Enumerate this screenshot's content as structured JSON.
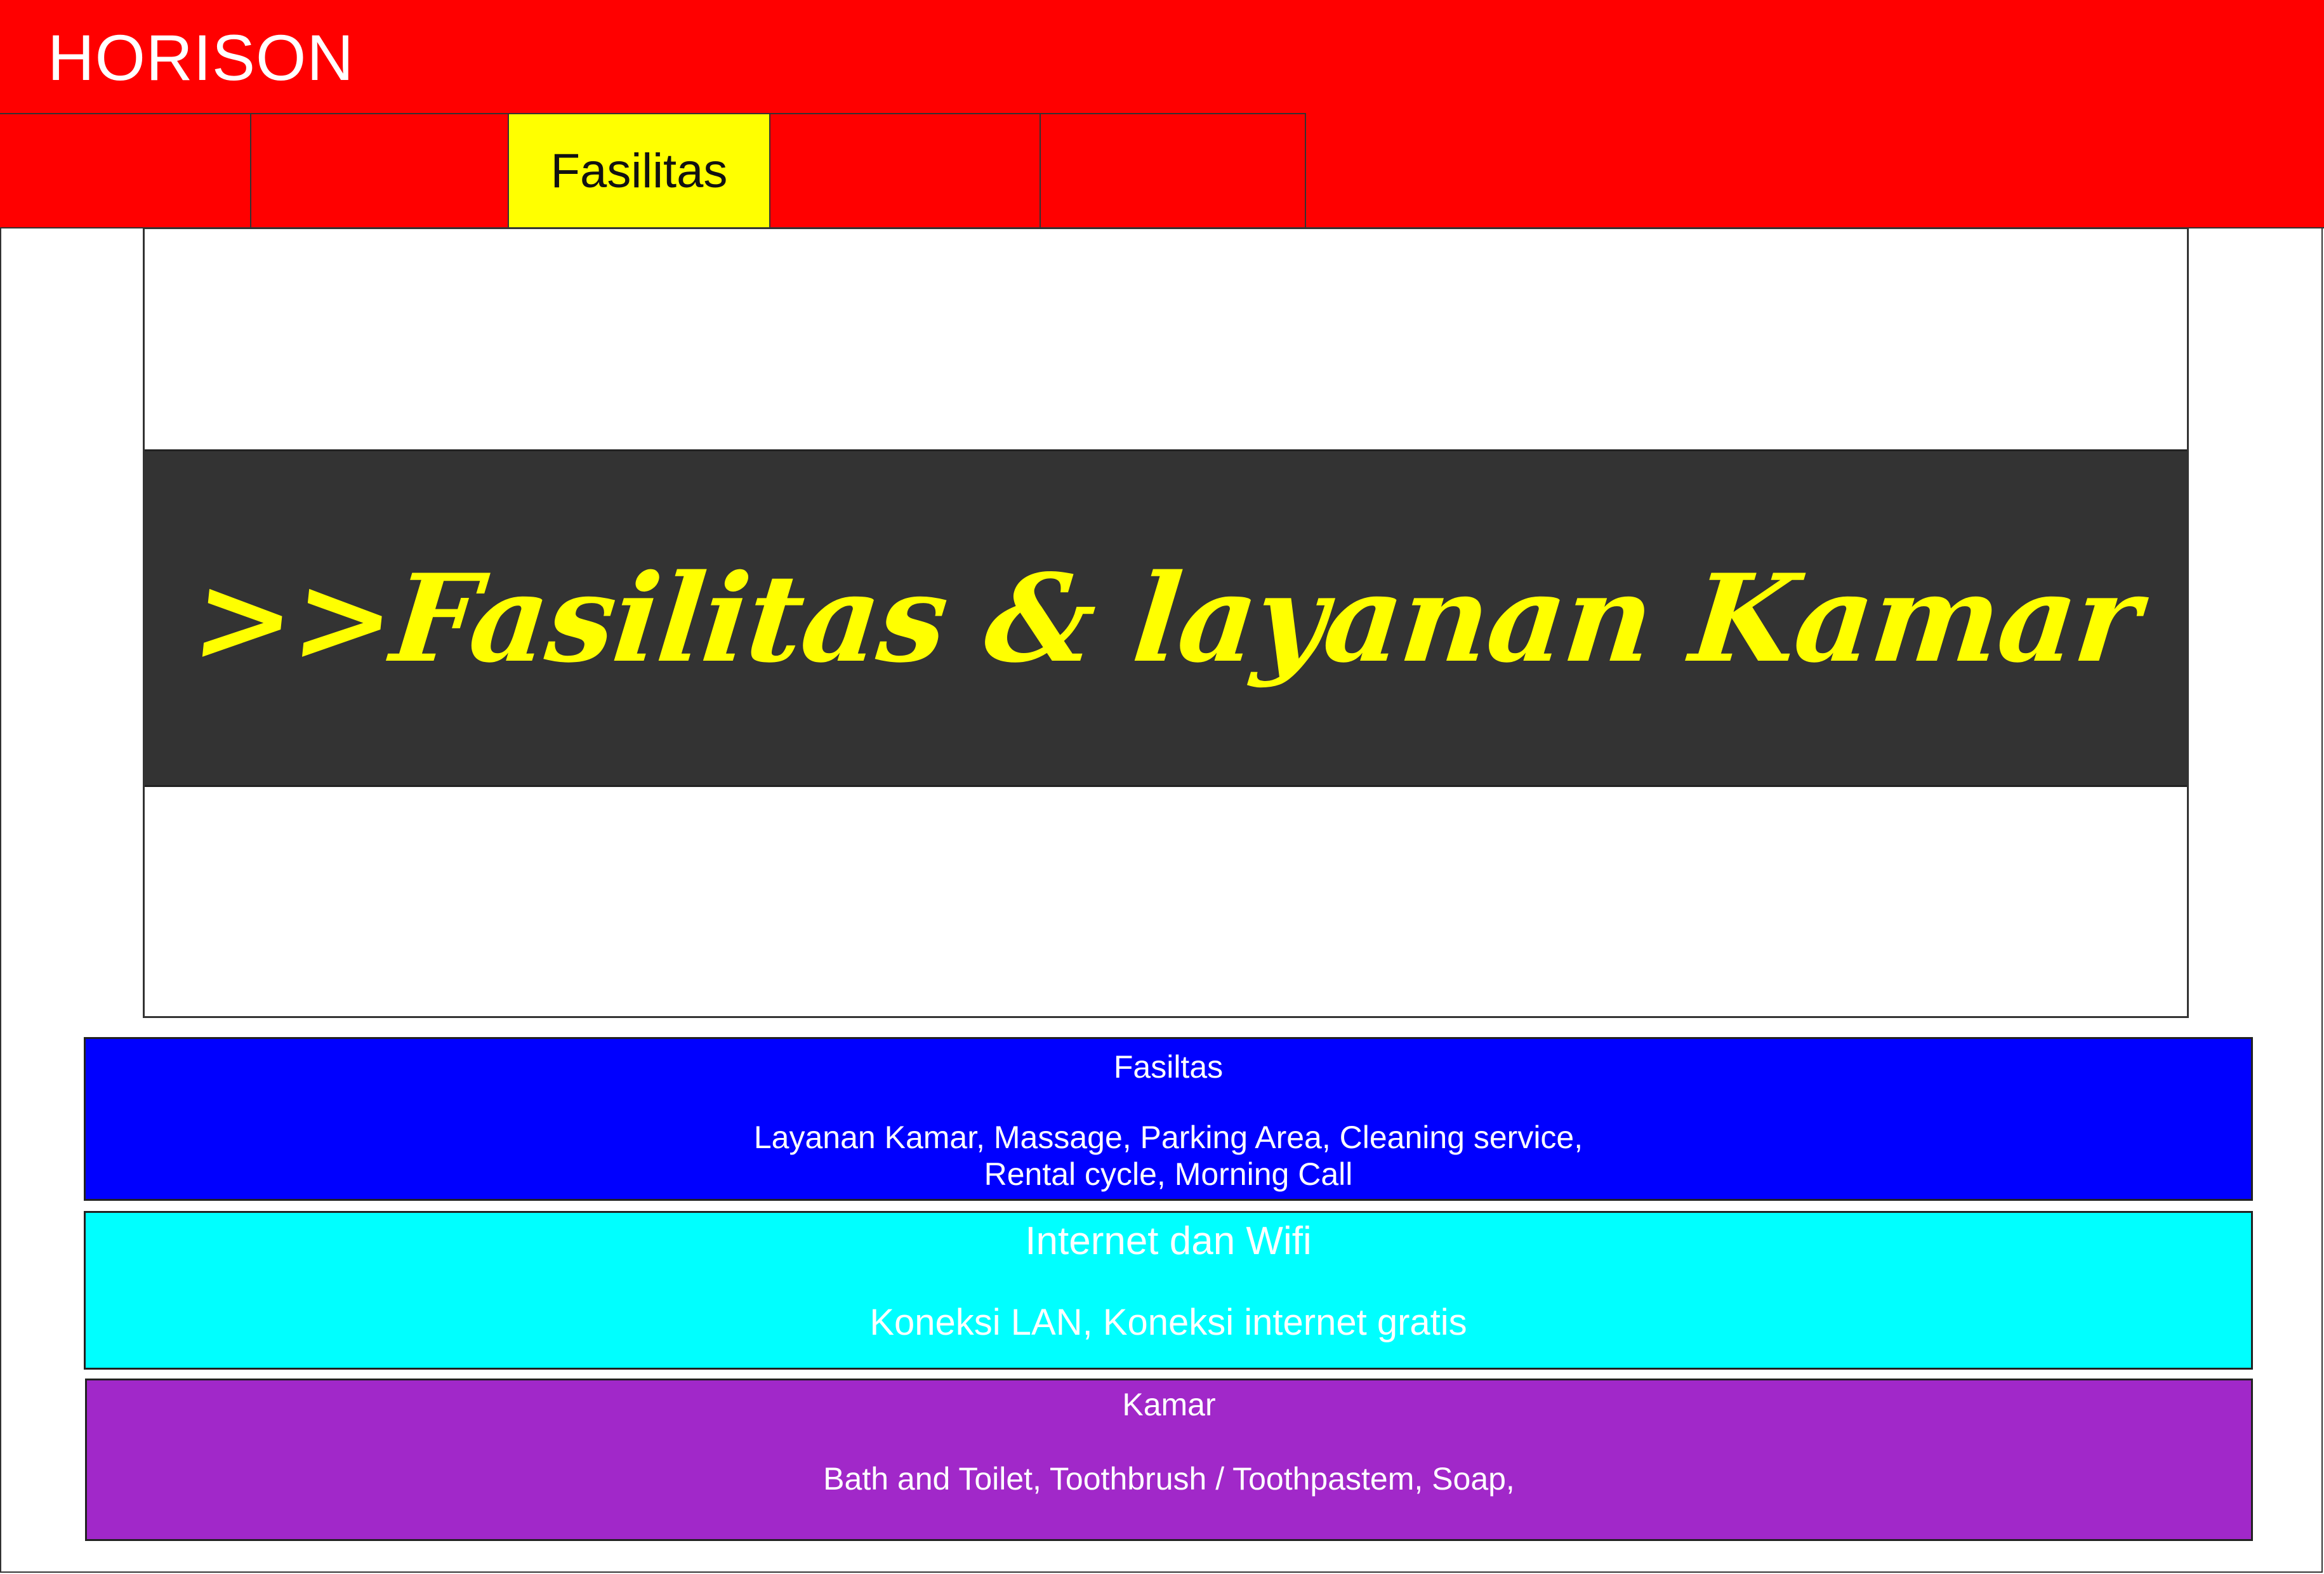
{
  "header": {
    "brand": "HORISON",
    "background_color": "#ff0000"
  },
  "nav": {
    "tabs": [
      {
        "label": ""
      },
      {
        "label": ""
      },
      {
        "label": "Fasilitas",
        "active": true,
        "active_color": "#ffff00"
      },
      {
        "label": ""
      },
      {
        "label": ""
      }
    ]
  },
  "hero": {
    "title": ">>Fasilitas & layanan Kamar",
    "band_color": "#333333",
    "title_color": "#ffff00"
  },
  "sections": {
    "fasilitas": {
      "title": "Fasiltas",
      "body": "Layanan Kamar, Massage, Parking Area, Cleaning service, Rental cycle, Morning Call",
      "color": "#0000ff"
    },
    "internet": {
      "title": "Internet dan Wifi",
      "body": "Koneksi LAN, Koneksi internet gratis",
      "color": "#00ffff"
    },
    "kamar": {
      "title": "Kamar",
      "body": "Bath and Toilet, Toothbrush / Toothpastem, Soap,",
      "color": "#a128c9"
    }
  }
}
